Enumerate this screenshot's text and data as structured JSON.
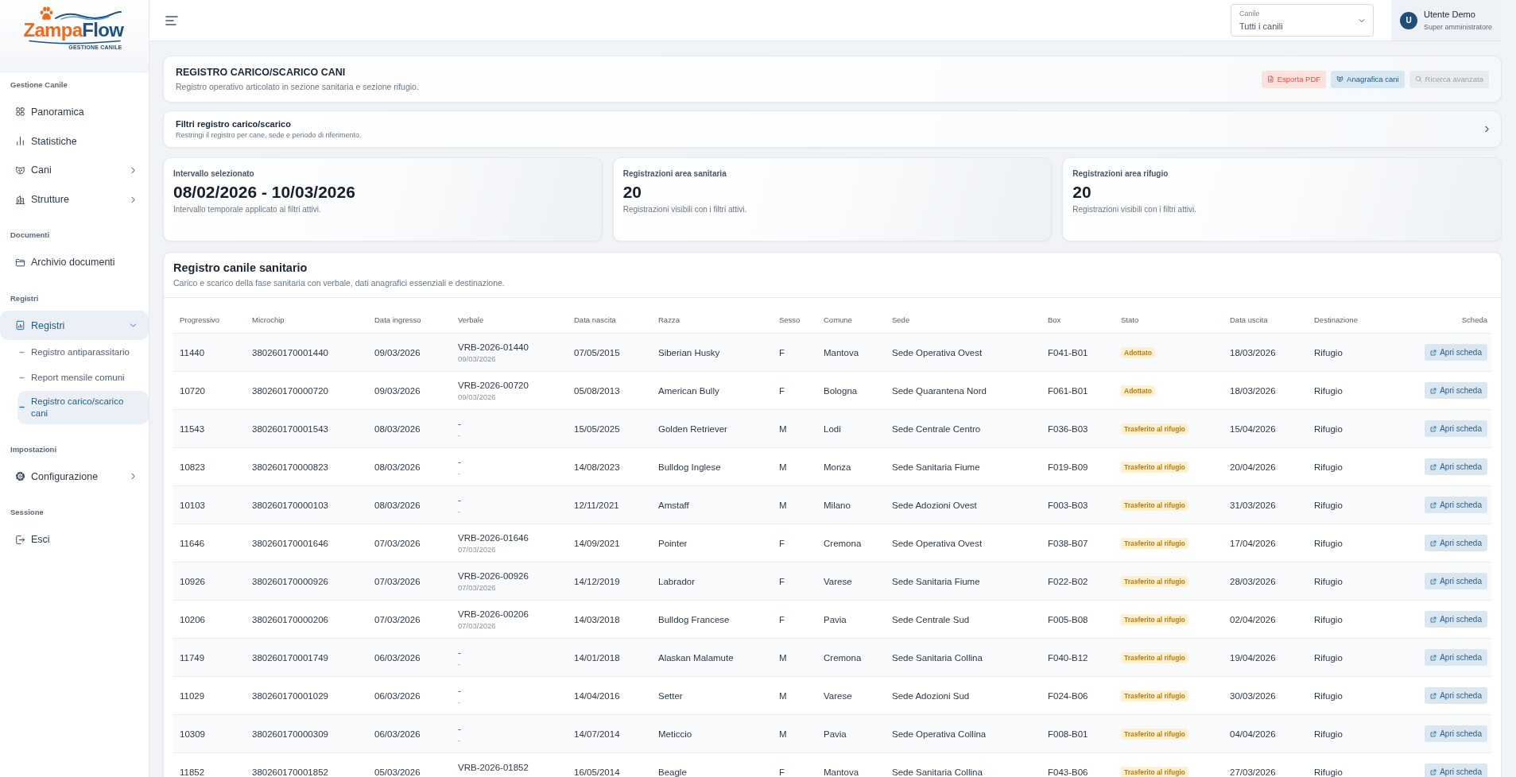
{
  "sidebar": {
    "logo": {
      "brand_start": "Zampa",
      "brand_end": "Flow",
      "tagline": "GESTIONE CANILE"
    },
    "sections": [
      {
        "title": "Gestione Canile",
        "items": [
          {
            "label": "Panoramica",
            "kind": "link",
            "selected": false
          },
          {
            "label": "Statistiche",
            "kind": "link",
            "selected": false
          },
          {
            "label": "Cani",
            "kind": "group",
            "expanded": false,
            "selected": false
          },
          {
            "label": "Strutture",
            "kind": "group",
            "expanded": false,
            "selected": false
          }
        ]
      },
      {
        "title": "Documenti",
        "items": [
          {
            "label": "Archivio documenti",
            "kind": "link",
            "selected": false
          }
        ]
      },
      {
        "title": "Registri",
        "items": [
          {
            "label": "Registri",
            "kind": "group",
            "expanded": true,
            "selected": true,
            "children": [
              {
                "label": "Registro antiparassitario",
                "selected": false
              },
              {
                "label": "Report mensile comuni",
                "selected": false
              },
              {
                "label": "Registro carico/scarico cani",
                "selected": true
              }
            ]
          }
        ]
      },
      {
        "title": "Impostazioni",
        "items": [
          {
            "label": "Configurazione",
            "kind": "group",
            "expanded": false,
            "selected": false
          }
        ]
      },
      {
        "title": "Sessione",
        "items": [
          {
            "label": "Esci",
            "kind": "link",
            "selected": false
          }
        ]
      }
    ]
  },
  "topbar": {
    "site_select": {
      "label": "Canile",
      "value": "Tutti i canili"
    },
    "user": {
      "initial": "U",
      "name": "Utente Demo",
      "role": "Super amministratore"
    }
  },
  "header": {
    "title": "REGISTRO CARICO/SCARICO CANI",
    "subtitle": "Registro operativo articolato in sezione sanitaria e sezione rifugio.",
    "actions": [
      {
        "label": "Esporta PDF",
        "kind": "pdf",
        "disabled": false
      },
      {
        "label": "Anagrafica cani",
        "kind": "registry",
        "disabled": false
      },
      {
        "label": "Ricerca avanzata",
        "kind": "search",
        "disabled": true
      }
    ]
  },
  "filters": {
    "title": "Filtri registro carico/scarico",
    "subtitle": "Restringi il registro per cane, sede e periodo di riferimento.",
    "expanded": false
  },
  "stats": [
    {
      "label": "Intervallo selezionato",
      "value": "08/02/2026 - 10/03/2026",
      "note": "Intervallo temporale applicato ai filtri attivi."
    },
    {
      "label": "Registrazioni area sanitaria",
      "value": "20",
      "note": "Registrazioni visibili con i filtri attivi."
    },
    {
      "label": "Registrazioni area rifugio",
      "value": "20",
      "note": "Registrazioni visibili con i filtri attivi."
    }
  ],
  "table": {
    "title": "Registro canile sanitario",
    "subtitle": "Carico e scarico della fase sanitaria con verbale, dati anagrafici essenziali e destinazione.",
    "columns": [
      "Progressivo",
      "Microchip",
      "Data ingresso",
      "Verbale",
      "Data nascita",
      "Razza",
      "Sesso",
      "Comune",
      "Sede",
      "Box",
      "Stato",
      "Data uscita",
      "Destinazione",
      "Scheda"
    ],
    "rows": [
      {
        "progressivo": "11440",
        "microchip": "380260170001440",
        "data_ingresso": "09/03/2026",
        "verbale": {
          "numero": "VRB-2026-01440",
          "data": "09/03/2026"
        },
        "data_nascita": "07/05/2015",
        "razza": "Siberian Husky",
        "sesso": "F",
        "comune": "Mantova",
        "sede": "Sede Operativa Ovest",
        "box": "F041-B01",
        "stato": "Adottato",
        "data_uscita": "18/03/2026",
        "destinazione": "Rifugio",
        "scheda": "Apri scheda"
      },
      {
        "progressivo": "10720",
        "microchip": "380260170000720",
        "data_ingresso": "09/03/2026",
        "verbale": {
          "numero": "VRB-2026-00720",
          "data": "09/03/2026"
        },
        "data_nascita": "05/08/2013",
        "razza": "American Bully",
        "sesso": "F",
        "comune": "Bologna",
        "sede": "Sede Quarantena Nord",
        "box": "F061-B01",
        "stato": "Adottato",
        "data_uscita": "18/03/2026",
        "destinazione": "Rifugio",
        "scheda": "Apri scheda"
      },
      {
        "progressivo": "11543",
        "microchip": "380260170001543",
        "data_ingresso": "08/03/2026",
        "verbale": {
          "numero": "-",
          "data": "-"
        },
        "data_nascita": "15/05/2025",
        "razza": "Golden Retriever",
        "sesso": "M",
        "comune": "Lodi",
        "sede": "Sede Centrale Centro",
        "box": "F036-B03",
        "stato": "Trasferito al rifugio",
        "data_uscita": "15/04/2026",
        "destinazione": "Rifugio",
        "scheda": "Apri scheda"
      },
      {
        "progressivo": "10823",
        "microchip": "380260170000823",
        "data_ingresso": "08/03/2026",
        "verbale": {
          "numero": "-",
          "data": "-"
        },
        "data_nascita": "14/08/2023",
        "razza": "Bulldog Inglese",
        "sesso": "M",
        "comune": "Monza",
        "sede": "Sede Sanitaria Fiume",
        "box": "F019-B09",
        "stato": "Trasferito al rifugio",
        "data_uscita": "20/04/2026",
        "destinazione": "Rifugio",
        "scheda": "Apri scheda"
      },
      {
        "progressivo": "10103",
        "microchip": "380260170000103",
        "data_ingresso": "08/03/2026",
        "verbale": {
          "numero": "-",
          "data": "-"
        },
        "data_nascita": "12/11/2021",
        "razza": "Amstaff",
        "sesso": "M",
        "comune": "Milano",
        "sede": "Sede Adozioni Ovest",
        "box": "F003-B03",
        "stato": "Trasferito al rifugio",
        "data_uscita": "31/03/2026",
        "destinazione": "Rifugio",
        "scheda": "Apri scheda"
      },
      {
        "progressivo": "11646",
        "microchip": "380260170001646",
        "data_ingresso": "07/03/2026",
        "verbale": {
          "numero": "VRB-2026-01646",
          "data": "07/03/2026"
        },
        "data_nascita": "14/09/2021",
        "razza": "Pointer",
        "sesso": "F",
        "comune": "Cremona",
        "sede": "Sede Operativa Ovest",
        "box": "F038-B07",
        "stato": "Trasferito al rifugio",
        "data_uscita": "17/04/2026",
        "destinazione": "Rifugio",
        "scheda": "Apri scheda"
      },
      {
        "progressivo": "10926",
        "microchip": "380260170000926",
        "data_ingresso": "07/03/2026",
        "verbale": {
          "numero": "VRB-2026-00926",
          "data": "07/03/2026"
        },
        "data_nascita": "14/12/2019",
        "razza": "Labrador",
        "sesso": "F",
        "comune": "Varese",
        "sede": "Sede Sanitaria Fiume",
        "box": "F022-B02",
        "stato": "Trasferito al rifugio",
        "data_uscita": "28/03/2026",
        "destinazione": "Rifugio",
        "scheda": "Apri scheda"
      },
      {
        "progressivo": "10206",
        "microchip": "380260170000206",
        "data_ingresso": "07/03/2026",
        "verbale": {
          "numero": "VRB-2026-00206",
          "data": "07/03/2026"
        },
        "data_nascita": "14/03/2018",
        "razza": "Bulldog Francese",
        "sesso": "F",
        "comune": "Pavia",
        "sede": "Sede Centrale Sud",
        "box": "F005-B08",
        "stato": "Trasferito al rifugio",
        "data_uscita": "02/04/2026",
        "destinazione": "Rifugio",
        "scheda": "Apri scheda"
      },
      {
        "progressivo": "11749",
        "microchip": "380260170001749",
        "data_ingresso": "06/03/2026",
        "verbale": {
          "numero": "-",
          "data": "-"
        },
        "data_nascita": "14/01/2018",
        "razza": "Alaskan Malamute",
        "sesso": "M",
        "comune": "Cremona",
        "sede": "Sede Sanitaria Collina",
        "box": "F040-B12",
        "stato": "Trasferito al rifugio",
        "data_uscita": "19/04/2026",
        "destinazione": "Rifugio",
        "scheda": "Apri scheda"
      },
      {
        "progressivo": "11029",
        "microchip": "380260170001029",
        "data_ingresso": "06/03/2026",
        "verbale": {
          "numero": "-",
          "data": "-"
        },
        "data_nascita": "14/04/2016",
        "razza": "Setter",
        "sesso": "M",
        "comune": "Varese",
        "sede": "Sede Adozioni Sud",
        "box": "F024-B06",
        "stato": "Trasferito al rifugio",
        "data_uscita": "30/03/2026",
        "destinazione": "Rifugio",
        "scheda": "Apri scheda"
      },
      {
        "progressivo": "10309",
        "microchip": "380260170000309",
        "data_ingresso": "06/03/2026",
        "verbale": {
          "numero": "-",
          "data": "-"
        },
        "data_nascita": "14/07/2014",
        "razza": "Meticcio",
        "sesso": "M",
        "comune": "Pavia",
        "sede": "Sede Operativa Collina",
        "box": "F008-B01",
        "stato": "Trasferito al rifugio",
        "data_uscita": "04/04/2026",
        "destinazione": "Rifugio",
        "scheda": "Apri scheda"
      },
      {
        "progressivo": "11852",
        "microchip": "380260170001852",
        "data_ingresso": "05/03/2026",
        "verbale": {
          "numero": "VRB-2026-01852"
        },
        "data_nascita": "16/05/2014",
        "razza": "Beagle",
        "sesso": "F",
        "comune": "Mantova",
        "sede": "Sede Sanitaria Collina",
        "box": "F043-B06",
        "stato": "Trasferito al rifugio",
        "data_uscita": "27/03/2026",
        "destinazione": "Rifugio",
        "scheda": "Apri scheda"
      }
    ]
  }
}
